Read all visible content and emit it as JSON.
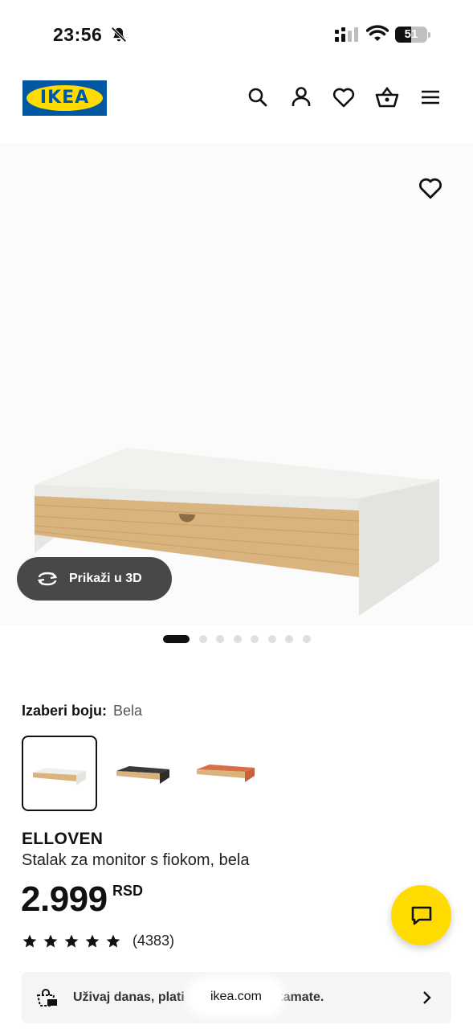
{
  "status_bar": {
    "time": "23:56",
    "battery_level": "51",
    "battery_fraction": 0.51,
    "icons": [
      "bell-off-icon",
      "cellular-signal-icon",
      "wifi-icon",
      "battery-icon"
    ]
  },
  "header": {
    "logo_text": "IKEA",
    "icons": [
      "search-icon",
      "user-icon",
      "heart-icon",
      "basket-icon",
      "menu-icon"
    ]
  },
  "gallery": {
    "view_3d_label": "Prikaži u 3D",
    "image_count": 8,
    "active_index": 0
  },
  "color_picker": {
    "label": "Izaberi boju:",
    "selected_value": "Bela",
    "options": [
      "white",
      "black",
      "orange"
    ]
  },
  "product": {
    "name": "ELLOVEN",
    "description": "Stalak za monitor s fiokom, bela",
    "price": "2.999",
    "currency": "RSD",
    "rating_stars": 5,
    "review_count": "(4383)"
  },
  "promo": {
    "text_start": "Uživaj danas, plati",
    "text_end": "kamate."
  },
  "browser": {
    "url": "ikea.com"
  },
  "colors": {
    "ikea_blue": "#0058a3",
    "ikea_yellow": "#ffdb00",
    "button_dark": "#484848"
  }
}
